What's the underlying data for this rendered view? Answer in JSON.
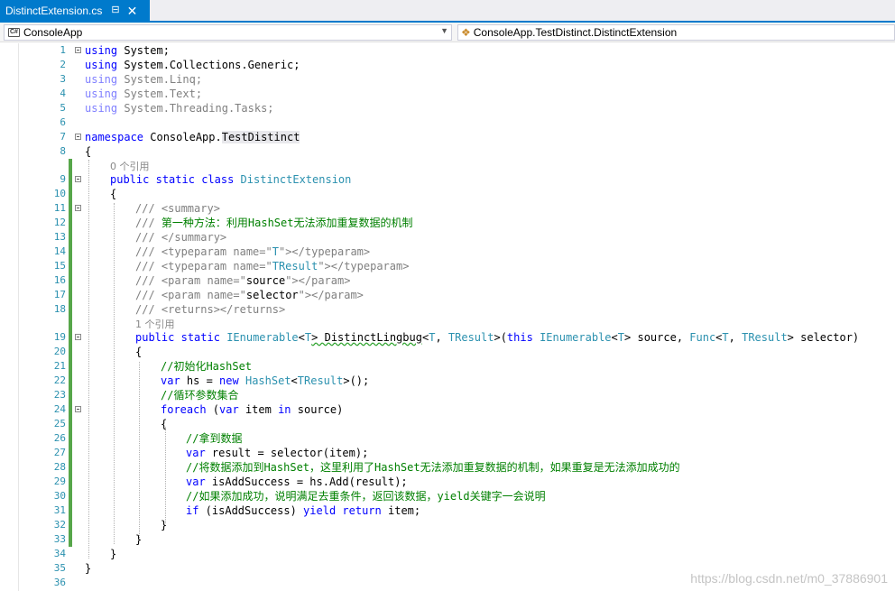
{
  "tab": {
    "filename": "DistinctExtension.cs",
    "pin_icon": "pin-icon",
    "close_icon": "close-icon"
  },
  "navbar": {
    "project_icon_label": "C#",
    "project": "ConsoleApp",
    "type": "ConsoleApp.TestDistinct.DistinctExtension"
  },
  "code_lines": {
    "l1": [
      "using",
      " System;"
    ],
    "l2": [
      "using",
      " System.Collections.Generic;"
    ],
    "l3": [
      "using",
      " System.Linq;"
    ],
    "l4": [
      "using",
      " System.Text;"
    ],
    "l5": [
      "using",
      " System.Threading.Tasks;"
    ],
    "l7": [
      "namespace",
      " ConsoleApp.",
      "TestDistinct"
    ],
    "l8": "{",
    "ref0": "0 个引用",
    "l9": [
      "public",
      " ",
      "static",
      " ",
      "class",
      " ",
      "DistinctExtension"
    ],
    "l10": "{",
    "l11": [
      "///",
      " <summary>"
    ],
    "l12": [
      "///",
      " 第一种方法：利用HashSet无法添加重复数据的机制"
    ],
    "l13": [
      "///",
      " </summary>"
    ],
    "l14": [
      "///",
      " <typeparam name=\"",
      "T",
      "\"></typeparam>"
    ],
    "l15": [
      "///",
      " <typeparam name=\"",
      "TResult",
      "\"></typeparam>"
    ],
    "l16": [
      "///",
      " <param name=\"",
      "source",
      "\"></param>"
    ],
    "l17": [
      "///",
      " <param name=\"",
      "selector",
      "\"></param>"
    ],
    "l18": [
      "///",
      " <returns></returns>"
    ],
    "ref1": "1 个引用",
    "l19": [
      "public",
      " ",
      "static",
      " ",
      "IEnumerable",
      "<",
      "T",
      "> DistinctLingbug",
      "<",
      "T",
      ", ",
      "TResult",
      ">(",
      "this",
      " ",
      "IEnumerable",
      "<",
      "T",
      "> source, ",
      "Func",
      "<",
      "T",
      ", ",
      "TResult",
      "> selector)"
    ],
    "l20": "{",
    "l21": "//初始化HashSet",
    "l22": [
      "var",
      " hs = ",
      "new",
      " ",
      "HashSet",
      "<",
      "TResult",
      ">();"
    ],
    "l23": "//循环参数集合",
    "l24": [
      "foreach",
      " (",
      "var",
      " item ",
      "in",
      " source)"
    ],
    "l25": "{",
    "l26": "//拿到数据",
    "l27": [
      "var",
      " result = selector(item);"
    ],
    "l28": "//将数据添加到HashSet，这里利用了HashSet无法添加重复数据的机制，如果重复是无法添加成功的",
    "l29": [
      "var",
      " isAddSuccess = hs.Add(result);"
    ],
    "l30": "//如果添加成功，说明满足去重条件，返回该数据，yield关键字一会说明",
    "l31": [
      "if",
      " (isAddSuccess) ",
      "yield",
      " ",
      "return",
      " item;"
    ],
    "l32": "}",
    "l33": "}",
    "l34": "}",
    "l35": "}",
    "l36": ""
  },
  "line_numbers": [
    "1",
    "2",
    "3",
    "4",
    "5",
    "6",
    "7",
    "8",
    "9",
    "10",
    "11",
    "12",
    "13",
    "14",
    "15",
    "16",
    "17",
    "18",
    "19",
    "20",
    "21",
    "22",
    "23",
    "24",
    "25",
    "26",
    "27",
    "28",
    "29",
    "30",
    "31",
    "32",
    "33",
    "34",
    "35",
    "36"
  ],
  "watermark": "https://blog.csdn.net/m0_37886901",
  "colors": {
    "accent": "#007acc",
    "keyword": "#0000ff",
    "type": "#2b91af",
    "comment": "#008000",
    "change_bar": "#57a64a"
  }
}
